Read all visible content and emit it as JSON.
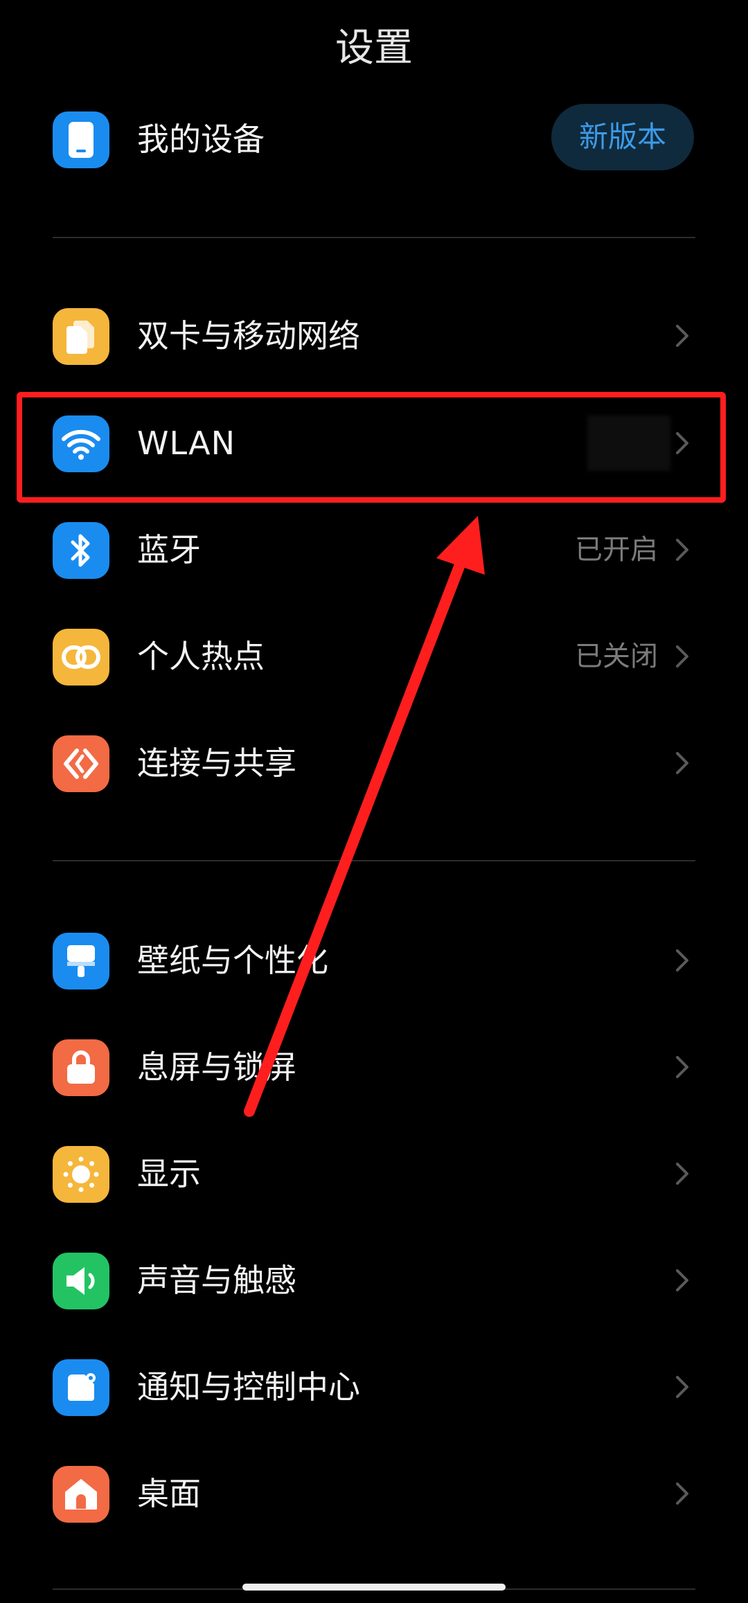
{
  "header": {
    "title": "设置"
  },
  "my_device": {
    "label": "我的设备",
    "badge": "新版本"
  },
  "network": [
    {
      "label": "双卡与移动网络",
      "value": ""
    },
    {
      "label": "WLAN",
      "value": ""
    },
    {
      "label": "蓝牙",
      "value": "已开启"
    },
    {
      "label": "个人热点",
      "value": "已关闭"
    },
    {
      "label": "连接与共享",
      "value": ""
    }
  ],
  "personal": [
    {
      "label": "壁纸与个性化"
    },
    {
      "label": "息屏与锁屏"
    },
    {
      "label": "显示"
    },
    {
      "label": "声音与触感"
    },
    {
      "label": "通知与控制中心"
    },
    {
      "label": "桌面"
    }
  ],
  "icons": {
    "my_device": "phone-icon",
    "sim": "sim-card-icon",
    "wlan": "wifi-icon",
    "bluetooth": "bluetooth-icon",
    "hotspot": "hotspot-icon",
    "share": "connection-share-icon",
    "wallpaper": "wallpaper-brush-icon",
    "lock": "lock-icon",
    "display": "sun-icon",
    "sound": "speaker-icon",
    "notify": "notification-icon",
    "home": "home-icon",
    "chevron": "chevron-right-icon"
  },
  "colors": {
    "blue": "#1a8cf0",
    "yellow": "#f5b63c",
    "orange": "#f26b45",
    "green": "#23c363",
    "annotation": "#ff1e1e"
  }
}
